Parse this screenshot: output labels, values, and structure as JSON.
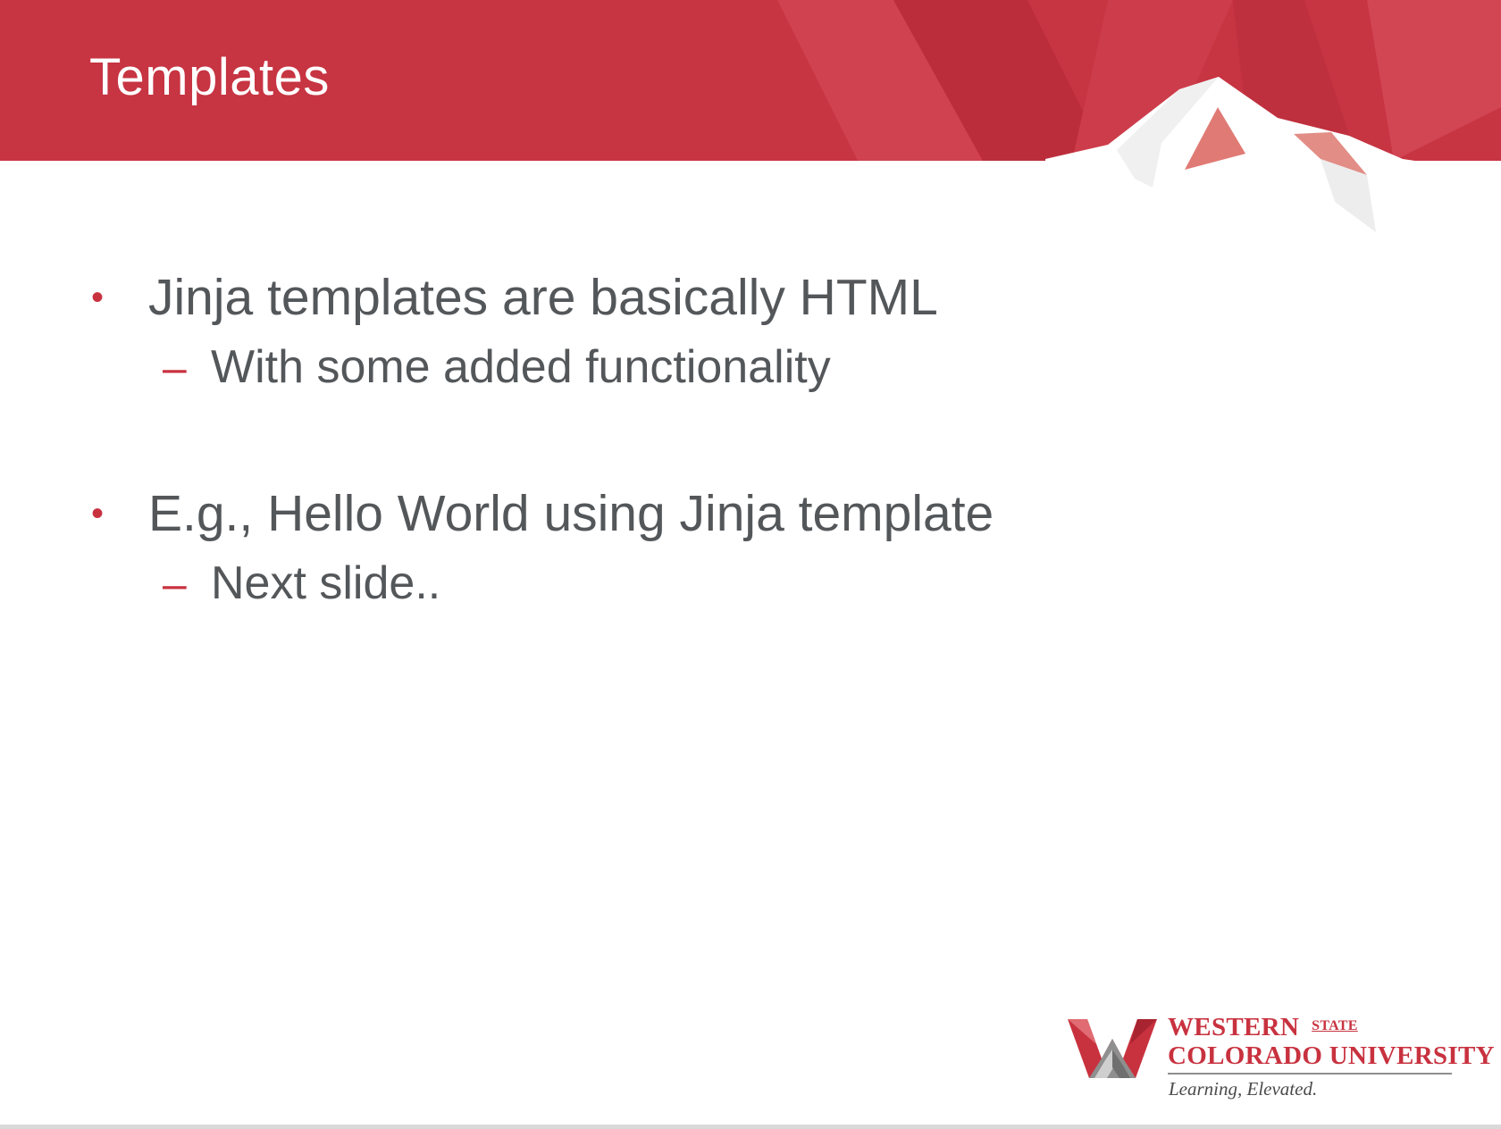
{
  "slide": {
    "title": "Templates",
    "bullets": [
      {
        "text": "Jinja templates are basically HTML",
        "sub": "With some added functionality"
      },
      {
        "text": "E.g., Hello World using Jinja template",
        "sub": "Next slide.."
      }
    ],
    "bullet_marker": "•",
    "sub_marker": "–"
  },
  "logo": {
    "line1": "WESTERN",
    "state": "STATE",
    "line2": "COLORADO UNIVERSITY",
    "tagline": "Learning, Elevated."
  },
  "colors": {
    "brand_red": "#c8323f",
    "text_gray": "#54575a",
    "background": "#ffffff"
  }
}
